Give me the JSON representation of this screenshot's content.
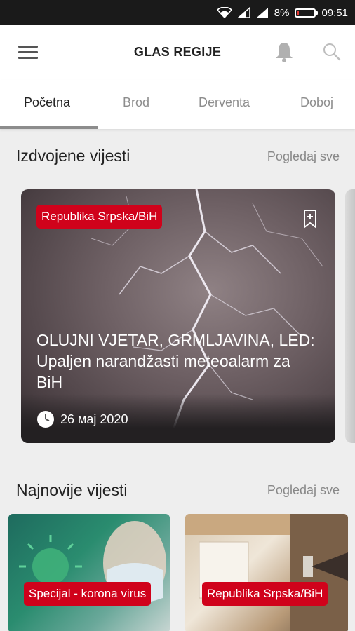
{
  "status_bar": {
    "battery": "8%",
    "time": "09:51"
  },
  "header": {
    "title": "GLAS REGIJE"
  },
  "tabs": [
    {
      "label": "Početna",
      "active": true
    },
    {
      "label": "Brod"
    },
    {
      "label": "Derventa"
    },
    {
      "label": "Doboj"
    }
  ],
  "featured": {
    "title": "Izdvojene vijesti",
    "see_all": "Pogledaj sve",
    "card": {
      "category": "Republika Srpska/BiH",
      "headline": "OLUJNI VJETAR, GRMLJAVINA, LED: Upaljen narandžasti meteoalarm za BiH",
      "date": "26 мај 2020"
    }
  },
  "latest": {
    "title": "Najnovije vijesti",
    "see_all": "Pogledaj sve",
    "cards": [
      {
        "category": "Specijal - korona virus"
      },
      {
        "category": "Republika Srpska/BiH"
      }
    ]
  },
  "colors": {
    "accent": "#d0021b",
    "tab_indicator": "#8c8c8c"
  }
}
